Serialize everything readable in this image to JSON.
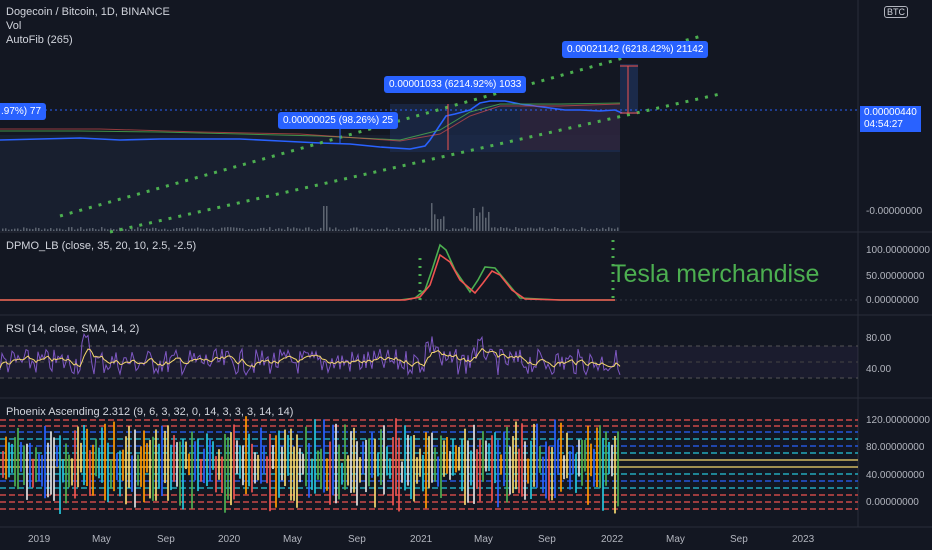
{
  "header": {
    "symbol": "Dogecoin / Bitcoin, 1D, BINANCE",
    "vol": "Vol",
    "autofib": "AutoFib (265)",
    "currency": "BTC"
  },
  "price_tag": {
    "value": "0.00000440",
    "countdown": "04:54:27"
  },
  "annotations": [
    {
      "text": ".97%) 77"
    },
    {
      "text": "0.00000025 (98.26%) 25"
    },
    {
      "text": "0.00001033 (6214.92%) 1033"
    },
    {
      "text": "0.00021142 (6218.42%) 21142"
    }
  ],
  "pane_titles": {
    "dpmo": "DPMO_LB (close, 35, 20, 10, 2.5, -2.5)",
    "rsi": "RSI (14, close, SMA, 14, 2)",
    "phoenix": "Phoenix Ascending 2.312 (9, 6, 3, 32, 0, 14, 3, 3, 3, 14, 14)"
  },
  "axis_ticks": {
    "main": [
      "-0.00000000"
    ],
    "dpmo": [
      "100.00000000",
      "50.00000000",
      "0.00000000"
    ],
    "rsi": [
      "80.00",
      "40.00"
    ],
    "phoenix": [
      "120.00000000",
      "80.00000000",
      "40.00000000",
      "0.00000000"
    ]
  },
  "time_axis": [
    "2019",
    "May",
    "Sep",
    "2020",
    "May",
    "Sep",
    "2021",
    "May",
    "Sep",
    "2022",
    "May",
    "Sep",
    "2023"
  ],
  "text_note": "Tesla merchandise",
  "colors": {
    "background": "#131722",
    "price_line": "#2962ff",
    "trend_dots": "#4caf50",
    "rsi_line": "#7e57c2",
    "rsi_ma": "#f5d76e",
    "dpmo_up": "#4caf50",
    "dpmo_down": "#ef5350",
    "accent": "#2962ff"
  },
  "chart_data": [
    {
      "type": "line",
      "title": "Dogecoin / Bitcoin, 1D, BINANCE",
      "x": [
        "2018-12",
        "2019-03",
        "2019-06",
        "2019-09",
        "2019-12",
        "2020-03",
        "2020-06",
        "2020-09",
        "2020-12",
        "2021-01",
        "2021-02",
        "2021-04",
        "2021-05",
        "2021-06",
        "2021-08",
        "2021-10",
        "2021-12",
        "2022-01"
      ],
      "values": [
        8e-07,
        7.5e-07,
        7e-07,
        6.5e-07,
        6e-07,
        6e-07,
        6e-07,
        6.5e-07,
        7e-07,
        1.5e-06,
        5e-06,
        8e-06,
        1.2e-05,
        1.1e-05,
        9.5e-06,
        8e-06,
        6e-06,
        4.4e-06
      ],
      "ylabel": ""
    },
    {
      "type": "line",
      "title": "DPMO_LB (close, 35, 20, 10, 2.5, -2.5)",
      "x": [
        "2019",
        "2020",
        "2020-12",
        "2021-01",
        "2021-02",
        "2021-03",
        "2021-04",
        "2021-05",
        "2021-06",
        "2021-07",
        "2022-01"
      ],
      "series": [
        {
          "values": [
            0,
            0,
            2,
            20,
            105,
            30,
            10,
            65,
            60,
            5,
            3
          ]
        },
        {
          "values": [
            0,
            0,
            1,
            10,
            90,
            50,
            15,
            55,
            58,
            15,
            2
          ]
        }
      ],
      "ylim": [
        0,
        120
      ]
    },
    {
      "type": "line",
      "title": "RSI (14, close, SMA, 14, 2)",
      "x": [
        "2018-12",
        "2019-05",
        "2019-09",
        "2020-01",
        "2020-05",
        "2020-09",
        "2021-01",
        "2021-05",
        "2021-09",
        "2022-01"
      ],
      "series": [
        {
          "values": [
            45,
            70,
            42,
            60,
            48,
            52,
            75,
            68,
            40,
            62
          ]
        },
        {
          "values": [
            48,
            58,
            46,
            55,
            50,
            50,
            62,
            60,
            45,
            55
          ]
        }
      ],
      "ylim": [
        20,
        90
      ],
      "bands": [
        70,
        30
      ]
    },
    {
      "type": "bar",
      "title": "Phoenix Ascending 2.312 (9, 6, 3, 32, 0, 14, 3, 3, 3, 14, 14)",
      "ylim": [
        -10,
        125
      ]
    }
  ]
}
